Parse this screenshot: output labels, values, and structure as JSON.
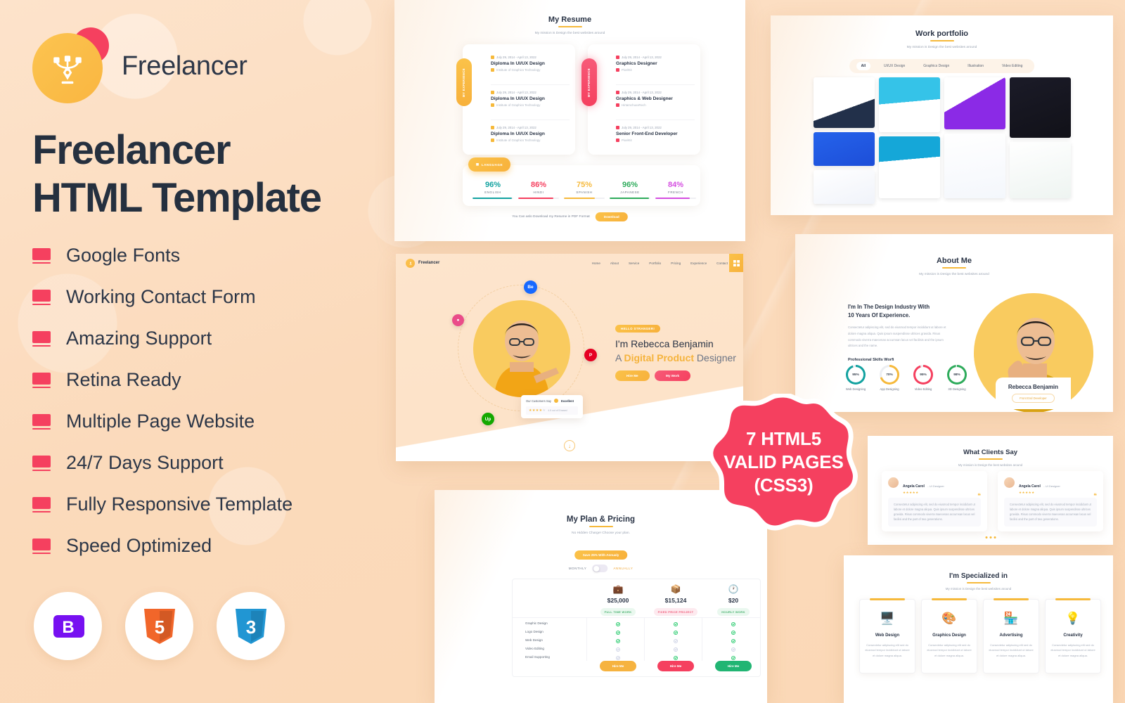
{
  "brand": {
    "name": "Freelancer",
    "logo_icon": "pen-tool-icon"
  },
  "headline": {
    "line1": "Freelancer",
    "line2": "HTML Template"
  },
  "features": [
    "Google Fonts",
    "Working Contact Form",
    "Amazing Support",
    "Retina Ready",
    "Multiple Page Website",
    "24/7 Days Support",
    "Fully Responsive Template",
    "Speed Optimized"
  ],
  "tech_badges": [
    {
      "name": "bootstrap-icon",
      "glyph": "B",
      "color": "#7710f1"
    },
    {
      "name": "html5-icon",
      "glyph": "5",
      "color": "#f1662a"
    },
    {
      "name": "css3-icon",
      "glyph": "3",
      "color": "#2196d3"
    }
  ],
  "seal": {
    "line1": "7 HTML5",
    "line2": "VALID PAGES",
    "line3": "(CSS3)",
    "color": "#f5405f"
  },
  "colors": {
    "background": "#fbdcbe",
    "accent_orange": "#f9b641",
    "accent_pink": "#f5405f",
    "dark_text": "#2a3446"
  },
  "resume": {
    "title": "My Resume",
    "subtitle": "My mission is Design the best websites around",
    "education_tag": "MY EXPERIENCE",
    "experience_tag": "MY EXPERIENCE",
    "education": [
      {
        "date": "July 29, 2014 - April 13, 2022",
        "role": "Diploma In UI/UX Design",
        "org": "Institute of Graphics Technology"
      },
      {
        "date": "July 29, 2014 - April 13, 2022",
        "role": "Diploma In UI/UX Design",
        "org": "Institute of Graphics Technology"
      },
      {
        "date": "July 29, 2014 - April 13, 2022",
        "role": "Diploma In UI/UX Design",
        "org": "Institute of Graphics Technology"
      }
    ],
    "experience": [
      {
        "date": "July 29, 2014 - April 13, 2022",
        "role": "Graphics Designer",
        "org": "PixelKit"
      },
      {
        "date": "July 29, 2014 - April 13, 2022",
        "role": "Graphics & Web Designer",
        "org": "HirtamchuxxRech"
      },
      {
        "date": "July 29, 2014 - April 13, 2022",
        "role": "Senior Front-End Developer",
        "org": "PixelKit"
      }
    ],
    "language_chip": "LANGUAGE",
    "languages": [
      {
        "name": "ENGLISH",
        "pct": "96%",
        "value": 96,
        "color": "#13a2a0"
      },
      {
        "name": "HINDI",
        "pct": "86%",
        "value": 86,
        "color": "#f5405f"
      },
      {
        "name": "SPANISH",
        "pct": "75%",
        "value": 75,
        "color": "#f6b93b"
      },
      {
        "name": "JAPANESE",
        "pct": "96%",
        "value": 96,
        "color": "#2eab5b"
      },
      {
        "name": "FRENCH",
        "pct": "84%",
        "value": 84,
        "color": "#d44ee0"
      }
    ],
    "download_text": "You Can aslo Download my Resume in PDF Format",
    "download_button": "Download"
  },
  "portfolio": {
    "title": "Work portfolio",
    "subtitle": "My mission is Design the best websites around",
    "filters": [
      "All",
      "UI/UX Design",
      "Graphics Design",
      "Illustration",
      "Video Editing"
    ],
    "active_filter": "All"
  },
  "hero": {
    "logo_text": "Freelancer",
    "nav": [
      "Home",
      "About",
      "Service",
      "Portfolio",
      "Pricing",
      "Experience",
      "Contact"
    ],
    "greeting_chip": "HELLO STRANGER!",
    "name_line": "I'm Rebecca Benjamin",
    "role_prefix": "A ",
    "role_highlight": "Digital Product",
    "role_suffix": " Designer",
    "btn_primary": "Hire Me",
    "btn_secondary": "My Work",
    "review_label": "Our Customers Say",
    "review_rating": "Excellent",
    "review_score": "4.5 out of 5 based",
    "social_orbs": [
      "Be",
      "dribbble",
      "Pinterest",
      "Up"
    ]
  },
  "about": {
    "title": "About Me",
    "subtitle": "My mission is Design the best websites around",
    "heading_line1": "I'm In The Design Industry With",
    "heading_line2": "10 Years Of Experience.",
    "body": "Consectetur adipiscing elit, sed do eiusmod tempor incididunt ut labore et dolore magna aliqua. Quis ipsum suspendisse ultrices gravida. Risus commodo viverra maecenas accumsan lacus vel facilisis and the ipsum ultrices and the name.",
    "skills_label": "Professional Skills Worfi",
    "skills": [
      {
        "label": "Web Designing",
        "pct": "95%",
        "value": 95,
        "color": "#13a2a0"
      },
      {
        "label": "App Designing",
        "pct": "70%",
        "value": 70,
        "color": "#f6b93b"
      },
      {
        "label": "Video Editing",
        "pct": "95%",
        "value": 95,
        "color": "#f5405f"
      },
      {
        "label": "3D Designing",
        "pct": "98%",
        "value": 98,
        "color": "#2eab5b"
      }
    ],
    "person_name": "Rebecca Benjamin",
    "person_role": "Front End Developer"
  },
  "pricing": {
    "title": "My Plan & Pricing",
    "subtitle": "No Hidden Charge! Choose your plan.",
    "save_badge": "Save 25% With Annualy",
    "toggle_monthly": "MONTHLY",
    "toggle_annually": "ANNUALLY",
    "features": [
      "Graphic Design",
      "Logo Design",
      "Web Design",
      "Video Editing",
      "Email Supporting"
    ],
    "plans": [
      {
        "icon": "briefcase-icon",
        "price": "$25,000",
        "badge": "FULL TIME WORK",
        "badge_color": "#eaf8ef",
        "badge_text": "#46b06d",
        "btn": "Hire Me",
        "btn_color": "#f6b340",
        "checks": [
          true,
          true,
          true,
          false,
          false
        ]
      },
      {
        "icon": "package-icon",
        "price": "$15,124",
        "badge": "FIXED PRICE PROJECT",
        "badge_color": "#fdeaef",
        "badge_text": "#f05a78",
        "btn": "Hire Me",
        "btn_color": "#f5405f",
        "checks": [
          true,
          true,
          false,
          false,
          true
        ]
      },
      {
        "icon": "clock-icon",
        "price": "$20",
        "badge": "HOURLY WORK",
        "badge_color": "#eaf8ef",
        "badge_text": "#46b06d",
        "btn": "Hire Me",
        "btn_color": "#21b573",
        "checks": [
          true,
          true,
          true,
          false,
          true
        ]
      }
    ]
  },
  "testimonials": {
    "title": "What Clients Say",
    "subtitle": "My mission is Design the best websites around",
    "items": [
      {
        "name": "Angela Carol",
        "role": "UI Designer",
        "stars": "★★★★★",
        "text": "Consectetur adipiscing elit, sed do eiusmod tempor incididunt ut labore et dolore magna aliqua. Quis ipsum suspendisse ultrices gravida. Risus commodo viverra maecenas accumsan lacus vel facilisi and the part of two generations."
      },
      {
        "name": "Angela Carol",
        "role": "UI Designer",
        "stars": "★★★★★",
        "text": "Consectetur adipiscing elit, sed do eiusmod tempor incididunt ut labore et dolore magna aliqua. Quis ipsum suspendisse ultrices gravida. Risus commodo viverra maecenas accumsan lacus vel facilisi and the part of two generations."
      }
    ]
  },
  "specialized": {
    "title": "I'm Specialized in",
    "subtitle": "My mission is Design the best websites around",
    "cards": [
      {
        "icon": "monitor-design-icon",
        "title": "Web Design",
        "desc": "Consectetur adipiscing elit sed do eiusmod tempor incididunt ut labore et dolore magna aliqua."
      },
      {
        "icon": "palette-brush-icon",
        "title": "Graphics Design",
        "desc": "Consectetur adipiscing elit sed do eiusmod tempor incididunt ut labore et dolore magna aliqua."
      },
      {
        "icon": "billboard-icon",
        "title": "Advertising",
        "desc": "Consectetur adipiscing elit sed do eiusmod tempor incididunt ut labore et dolore magna aliqua."
      },
      {
        "icon": "lightbulb-icon",
        "title": "Creativity",
        "desc": "Consectetur adipiscing elit sed do eiusmod tempor incididunt ut labore et dolore magna aliqua."
      }
    ]
  }
}
